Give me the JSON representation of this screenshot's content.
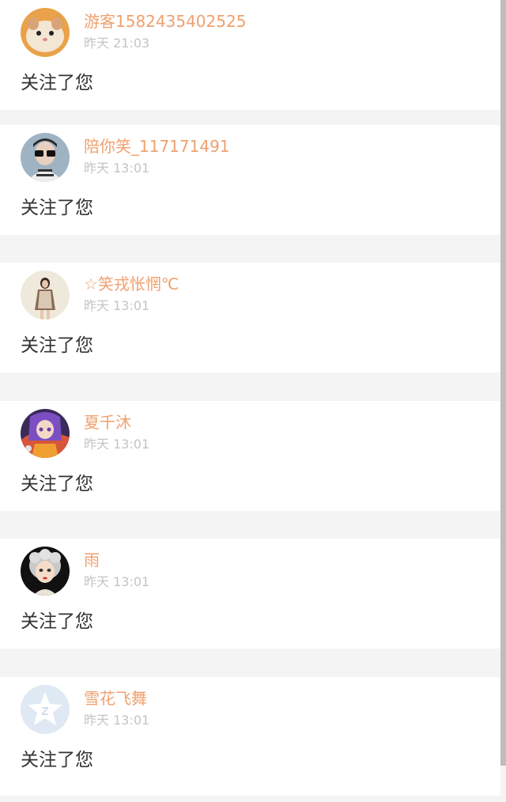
{
  "notifications": [
    {
      "username": "游客1582435402525",
      "time": "昨天 21:03",
      "message": "关注了您",
      "avatar": "hamster-avatar"
    },
    {
      "username": "陪你笑_117171491",
      "time": "昨天 13:01",
      "message": "关注了您",
      "avatar": "glasses-boy-avatar"
    },
    {
      "username": "☆笑戎怅惘℃",
      "time": "昨天 13:01",
      "message": "关注了您",
      "avatar": "standing-girl-avatar"
    },
    {
      "username": "夏千沐",
      "time": "昨天 13:01",
      "message": "关注了您",
      "avatar": "anime-girl-avatar"
    },
    {
      "username": "雨",
      "time": "昨天 13:01",
      "message": "关注了您",
      "avatar": "silver-hair-girl-avatar"
    },
    {
      "username": "雪花飞舞",
      "time": "昨天 13:01",
      "message": "关注了您",
      "avatar": "default-qq-avatar"
    }
  ],
  "colors": {
    "username": "#f0a06e",
    "timestamp": "#c4c4c4",
    "message": "#333333",
    "separator": "#f4f4f4"
  }
}
